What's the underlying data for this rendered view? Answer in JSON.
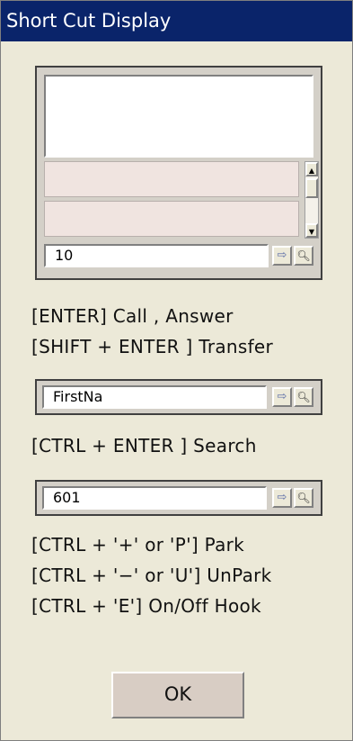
{
  "window": {
    "title": "Short Cut Display"
  },
  "group1": {
    "input_value": "10",
    "nav_icon": "arrow-right-icon",
    "search_icon": "magnifier-icon"
  },
  "shortcuts1": {
    "line1": "[ENTER]  Call ,  Answer",
    "line2": "[SHIFT + ENTER  ] Transfer"
  },
  "group2": {
    "input_value": "FirstNa"
  },
  "shortcuts2": {
    "line1": "[CTRL  + ENTER  ] Search"
  },
  "group3": {
    "input_value": "601"
  },
  "shortcuts3": {
    "line1": "[CTRL  + '+' or 'P'] Park",
    "line2": "[CTRL  + '−' or 'U'] UnPark",
    "line3": "[CTRL  + 'E'] On/Off Hook"
  },
  "ok_label": "OK",
  "colors": {
    "titlebar": "#0a246a",
    "dialog_bg": "#ece9d8",
    "list_row": "#f0e4e0"
  }
}
